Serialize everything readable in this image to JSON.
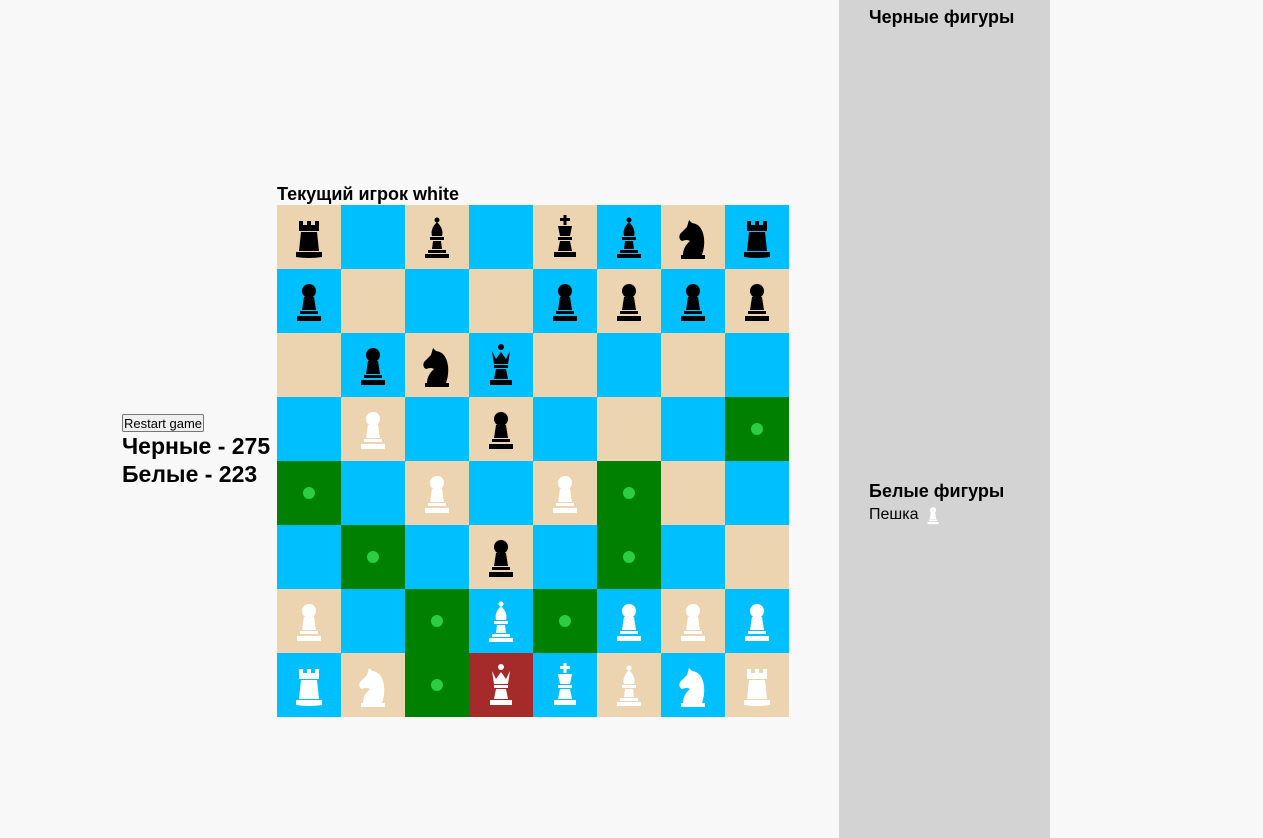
{
  "controls": {
    "restart_label": "Restart game"
  },
  "timers": {
    "black": "Черные - 275",
    "white": "Белые - 223"
  },
  "current_player": "Текущий игрок white",
  "board": {
    "colors": {
      "light": "#ecd4b0",
      "dark": "#00bfff",
      "available": "#008000",
      "selected": "#a52a2a",
      "dot": "#2ecc40"
    },
    "rows": [
      [
        "bR",
        "",
        "bB",
        "",
        "bK",
        "bB",
        "bN",
        "bR"
      ],
      [
        "bP",
        "",
        "",
        "",
        "bP",
        "bP",
        "bP",
        "bP"
      ],
      [
        "",
        "bP",
        "bN",
        "bQ",
        "",
        "",
        "",
        ""
      ],
      [
        "",
        "wP",
        "",
        "bP",
        "",
        "",
        "",
        ""
      ],
      [
        "",
        "",
        "wP",
        "",
        "wP",
        "",
        "",
        ""
      ],
      [
        "",
        "",
        "",
        "bP",
        "",
        "",
        "",
        ""
      ],
      [
        "wP",
        "",
        "",
        "wB",
        "",
        "wP",
        "wP",
        "wP"
      ],
      [
        "wR",
        "wN",
        "",
        "wQ",
        "wK",
        "wB",
        "wN",
        "wR"
      ]
    ],
    "available": [
      [
        3,
        7
      ],
      [
        4,
        0
      ],
      [
        4,
        5
      ],
      [
        5,
        1
      ],
      [
        5,
        5
      ],
      [
        6,
        2
      ],
      [
        6,
        4
      ],
      [
        7,
        2
      ]
    ],
    "selected": [
      7,
      3
    ]
  },
  "lost": {
    "black_title": "Черные фигуры",
    "white_title": "Белые фигуры",
    "white_items": [
      {
        "name": "Пешка",
        "icon": "white-pawn-icon"
      }
    ],
    "black_items": []
  }
}
